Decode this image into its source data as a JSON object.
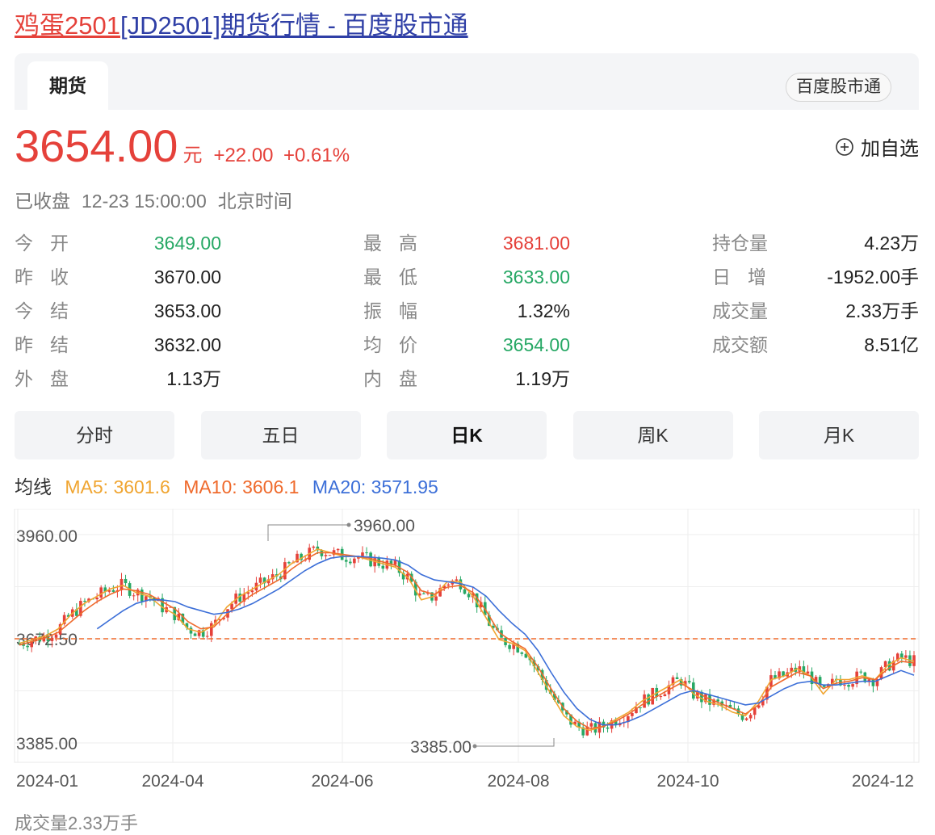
{
  "page_title": {
    "part1": "鸡蛋2501",
    "part2": "[JD2501]期货行情 - 百度股市通"
  },
  "tabs": {
    "active": "期货",
    "source": "百度股市通"
  },
  "quote": {
    "price": "3654.00",
    "unit": "元",
    "change": "+22.00",
    "change_pct": "+0.61%",
    "add_watch": "加自选"
  },
  "status": {
    "state": "已收盘",
    "time": "12-23 15:00:00",
    "tz": "北京时间"
  },
  "stats": [
    [
      {
        "label": "今开",
        "value": "3649.00",
        "color": "green"
      },
      {
        "label": "最高",
        "value": "3681.00",
        "color": "red"
      },
      {
        "label": "持仓量",
        "value": "4.23万",
        "color": ""
      }
    ],
    [
      {
        "label": "昨收",
        "value": "3670.00",
        "color": ""
      },
      {
        "label": "最低",
        "value": "3633.00",
        "color": "green"
      },
      {
        "label": "日增",
        "value": "-1952.00手",
        "color": ""
      }
    ],
    [
      {
        "label": "今结",
        "value": "3653.00",
        "color": ""
      },
      {
        "label": "振幅",
        "value": "1.32%",
        "color": ""
      },
      {
        "label": "成交量",
        "value": "2.33万手",
        "color": ""
      }
    ],
    [
      {
        "label": "昨结",
        "value": "3632.00",
        "color": ""
      },
      {
        "label": "均价",
        "value": "3654.00",
        "color": "green"
      },
      {
        "label": "成交额",
        "value": "8.51亿",
        "color": ""
      }
    ],
    [
      {
        "label": "外盘",
        "value": "1.13万",
        "color": ""
      },
      {
        "label": "内盘",
        "value": "1.19万",
        "color": ""
      }
    ]
  ],
  "period_tabs": [
    "分时",
    "五日",
    "日K",
    "周K",
    "月K"
  ],
  "period_active": 2,
  "ma": {
    "title": "均线",
    "ma5": "MA5: 3601.6",
    "ma10": "MA10: 3606.1",
    "ma20": "MA20: 3571.95"
  },
  "chart_data": {
    "type": "line",
    "ylim": [
      3385,
      3960
    ],
    "y_ticks": [
      "3960.00",
      "3672.50",
      "3385.00"
    ],
    "x_tick_labels": [
      "2024-01",
      "2024-04",
      "2024-06",
      "2024-08",
      "2024-10",
      "2024-12"
    ],
    "max_label": "3960.00",
    "min_label": "3385.00",
    "reference_value": 3672.5,
    "colors": {
      "up": "#e5413a",
      "down": "#27a865",
      "ma5": "#f0a531",
      "ma10": "#ef6a2c",
      "ma20": "#3c6fd8",
      "ref": "#ef6a2c"
    },
    "series": [
      {
        "name": "MA5",
        "values": [
          3660,
          3670,
          3680,
          3700,
          3740,
          3770,
          3790,
          3810,
          3820,
          3800,
          3790,
          3760,
          3740,
          3700,
          3690,
          3710,
          3760,
          3790,
          3810,
          3830,
          3850,
          3880,
          3900,
          3920,
          3910,
          3900,
          3900,
          3890,
          3880,
          3870,
          3840,
          3780,
          3790,
          3830,
          3830,
          3790,
          3730,
          3670,
          3660,
          3640,
          3580,
          3520,
          3460,
          3430,
          3420,
          3430,
          3450,
          3470,
          3500,
          3520,
          3540,
          3560,
          3520,
          3500,
          3490,
          3470,
          3460,
          3500,
          3560,
          3570,
          3590,
          3570,
          3520,
          3560,
          3560,
          3570,
          3560,
          3600,
          3620,
          3610
        ]
      },
      {
        "name": "MA10",
        "values": [
          3655,
          3665,
          3675,
          3690,
          3720,
          3750,
          3775,
          3795,
          3810,
          3805,
          3795,
          3775,
          3755,
          3720,
          3700,
          3705,
          3740,
          3770,
          3795,
          3815,
          3835,
          3865,
          3890,
          3910,
          3910,
          3905,
          3900,
          3895,
          3885,
          3875,
          3855,
          3805,
          3795,
          3815,
          3820,
          3800,
          3750,
          3690,
          3665,
          3645,
          3595,
          3535,
          3480,
          3445,
          3425,
          3430,
          3445,
          3465,
          3490,
          3510,
          3530,
          3550,
          3530,
          3510,
          3495,
          3480,
          3465,
          3490,
          3540,
          3560,
          3580,
          3570,
          3535,
          3550,
          3555,
          3565,
          3560,
          3590,
          3610,
          3606
        ]
      },
      {
        "name": "MA20",
        "values": [
          null,
          null,
          null,
          null,
          null,
          null,
          3700,
          3725,
          3750,
          3770,
          3780,
          3780,
          3775,
          3760,
          3750,
          3740,
          3745,
          3755,
          3770,
          3790,
          3810,
          3835,
          3860,
          3880,
          3895,
          3900,
          3900,
          3898,
          3895,
          3890,
          3875,
          3850,
          3835,
          3830,
          3825,
          3815,
          3790,
          3750,
          3715,
          3685,
          3640,
          3580,
          3525,
          3480,
          3450,
          3435,
          3435,
          3445,
          3460,
          3480,
          3500,
          3520,
          3530,
          3520,
          3510,
          3500,
          3490,
          3495,
          3515,
          3535,
          3550,
          3555,
          3545,
          3545,
          3550,
          3555,
          3555,
          3570,
          3585,
          3572
        ]
      }
    ]
  },
  "volume_label": "成交量2.33万手"
}
